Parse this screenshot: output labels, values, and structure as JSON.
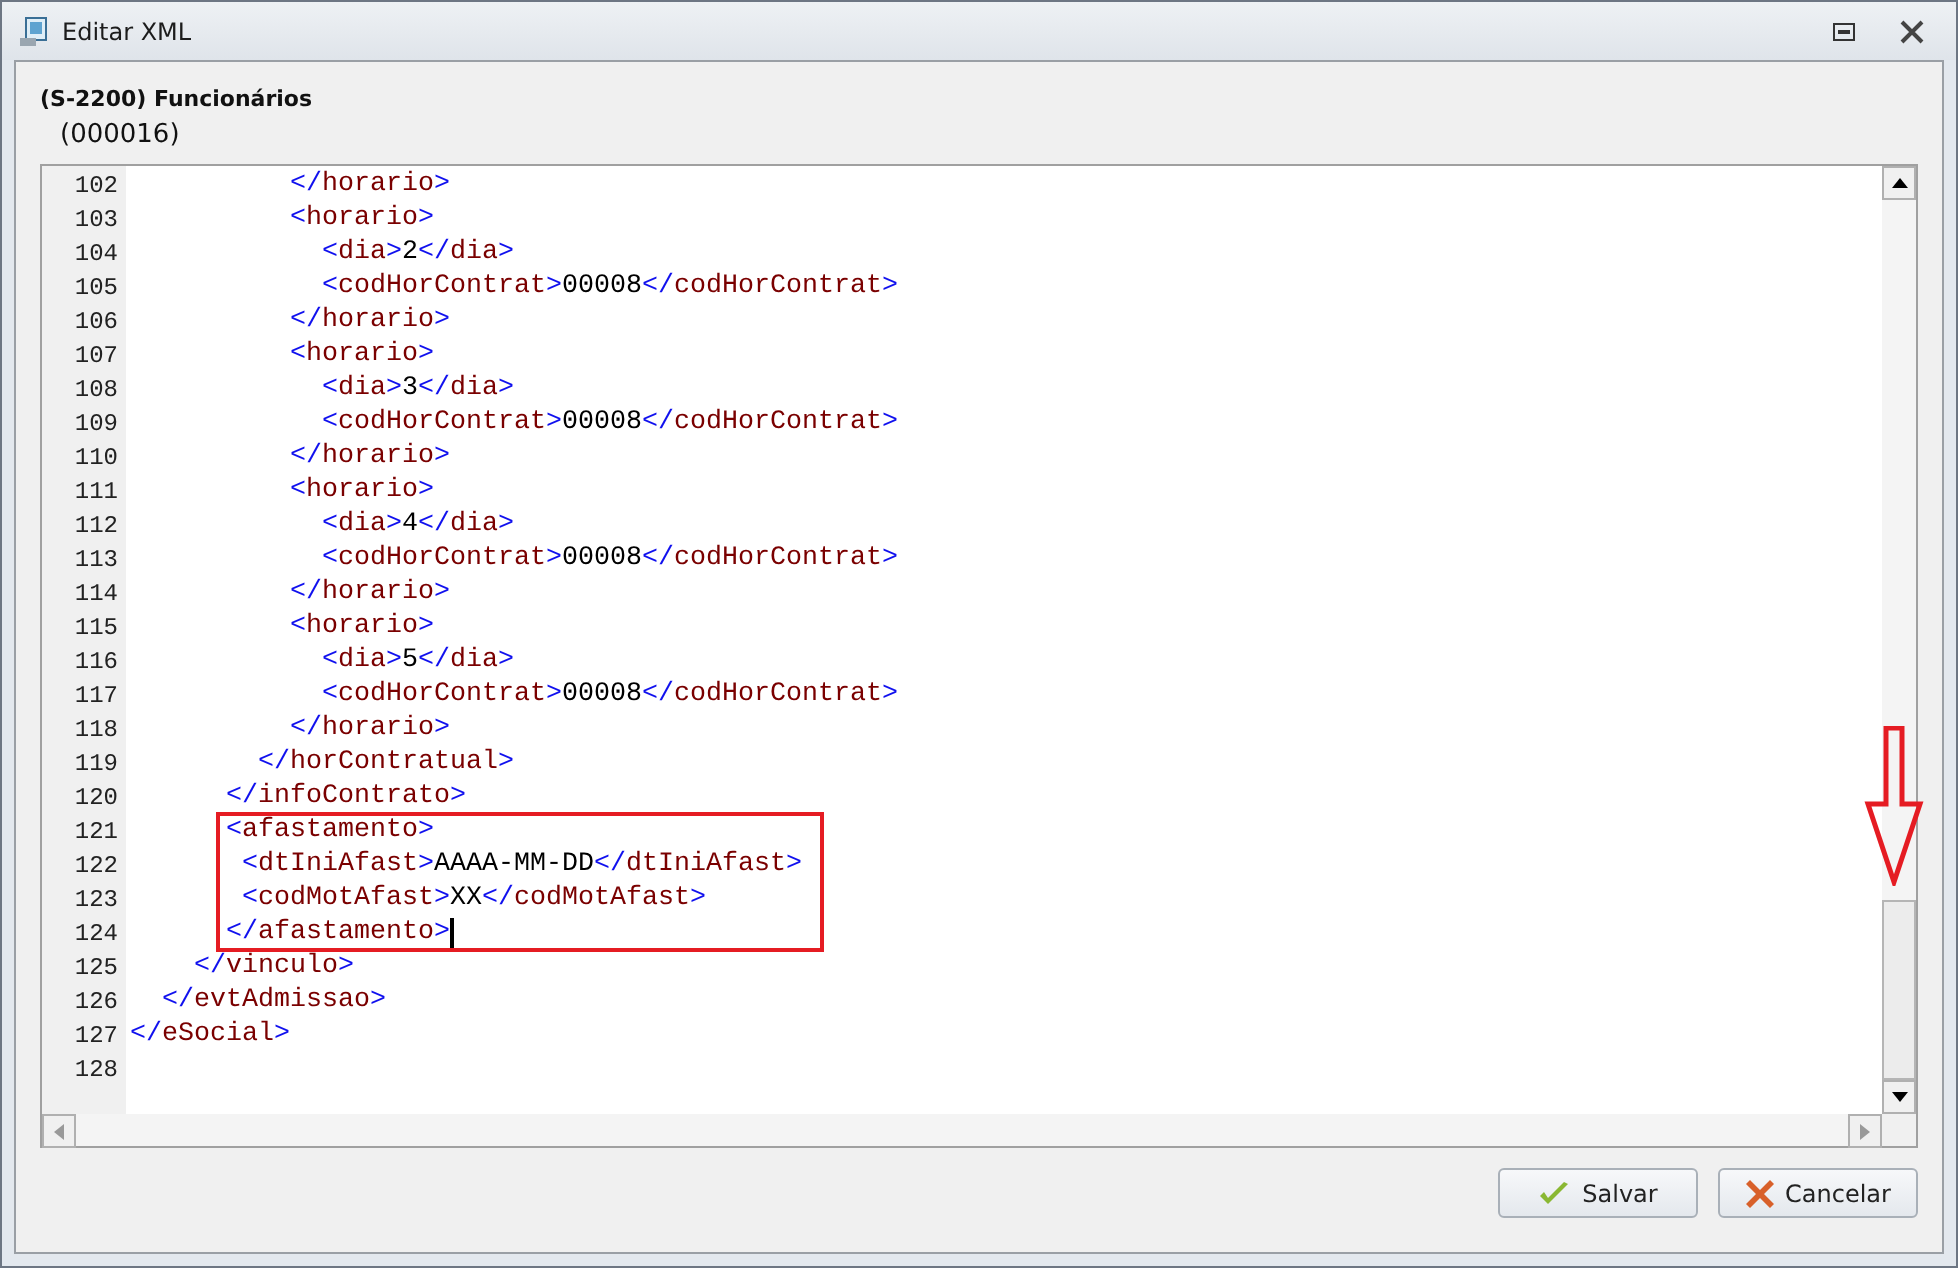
{
  "window": {
    "title": "Editar XML"
  },
  "header": {
    "title": "(S-2200) Funcionários",
    "code": "(000016)"
  },
  "editor": {
    "lines": [
      {
        "number": "102",
        "parts": [
          {
            "kind": "punct",
            "text": "          </"
          },
          {
            "kind": "name",
            "text": "horario"
          },
          {
            "kind": "punct",
            "text": ">"
          }
        ]
      },
      {
        "number": "103",
        "parts": [
          {
            "kind": "punct",
            "text": "          <"
          },
          {
            "kind": "name",
            "text": "horario"
          },
          {
            "kind": "punct",
            "text": ">"
          }
        ]
      },
      {
        "number": "104",
        "parts": [
          {
            "kind": "punct",
            "text": "            <"
          },
          {
            "kind": "name",
            "text": "dia"
          },
          {
            "kind": "punct",
            "text": ">"
          },
          {
            "kind": "text",
            "text": "2"
          },
          {
            "kind": "punct",
            "text": "</"
          },
          {
            "kind": "name",
            "text": "dia"
          },
          {
            "kind": "punct",
            "text": ">"
          }
        ]
      },
      {
        "number": "105",
        "parts": [
          {
            "kind": "punct",
            "text": "            <"
          },
          {
            "kind": "name",
            "text": "codHorContrat"
          },
          {
            "kind": "punct",
            "text": ">"
          },
          {
            "kind": "text",
            "text": "00008"
          },
          {
            "kind": "punct",
            "text": "</"
          },
          {
            "kind": "name",
            "text": "codHorContrat"
          },
          {
            "kind": "punct",
            "text": ">"
          }
        ]
      },
      {
        "number": "106",
        "parts": [
          {
            "kind": "punct",
            "text": "          </"
          },
          {
            "kind": "name",
            "text": "horario"
          },
          {
            "kind": "punct",
            "text": ">"
          }
        ]
      },
      {
        "number": "107",
        "parts": [
          {
            "kind": "punct",
            "text": "          <"
          },
          {
            "kind": "name",
            "text": "horario"
          },
          {
            "kind": "punct",
            "text": ">"
          }
        ]
      },
      {
        "number": "108",
        "parts": [
          {
            "kind": "punct",
            "text": "            <"
          },
          {
            "kind": "name",
            "text": "dia"
          },
          {
            "kind": "punct",
            "text": ">"
          },
          {
            "kind": "text",
            "text": "3"
          },
          {
            "kind": "punct",
            "text": "</"
          },
          {
            "kind": "name",
            "text": "dia"
          },
          {
            "kind": "punct",
            "text": ">"
          }
        ]
      },
      {
        "number": "109",
        "parts": [
          {
            "kind": "punct",
            "text": "            <"
          },
          {
            "kind": "name",
            "text": "codHorContrat"
          },
          {
            "kind": "punct",
            "text": ">"
          },
          {
            "kind": "text",
            "text": "00008"
          },
          {
            "kind": "punct",
            "text": "</"
          },
          {
            "kind": "name",
            "text": "codHorContrat"
          },
          {
            "kind": "punct",
            "text": ">"
          }
        ]
      },
      {
        "number": "110",
        "parts": [
          {
            "kind": "punct",
            "text": "          </"
          },
          {
            "kind": "name",
            "text": "horario"
          },
          {
            "kind": "punct",
            "text": ">"
          }
        ]
      },
      {
        "number": "111",
        "parts": [
          {
            "kind": "punct",
            "text": "          <"
          },
          {
            "kind": "name",
            "text": "horario"
          },
          {
            "kind": "punct",
            "text": ">"
          }
        ]
      },
      {
        "number": "112",
        "parts": [
          {
            "kind": "punct",
            "text": "            <"
          },
          {
            "kind": "name",
            "text": "dia"
          },
          {
            "kind": "punct",
            "text": ">"
          },
          {
            "kind": "text",
            "text": "4"
          },
          {
            "kind": "punct",
            "text": "</"
          },
          {
            "kind": "name",
            "text": "dia"
          },
          {
            "kind": "punct",
            "text": ">"
          }
        ]
      },
      {
        "number": "113",
        "parts": [
          {
            "kind": "punct",
            "text": "            <"
          },
          {
            "kind": "name",
            "text": "codHorContrat"
          },
          {
            "kind": "punct",
            "text": ">"
          },
          {
            "kind": "text",
            "text": "00008"
          },
          {
            "kind": "punct",
            "text": "</"
          },
          {
            "kind": "name",
            "text": "codHorContrat"
          },
          {
            "kind": "punct",
            "text": ">"
          }
        ]
      },
      {
        "number": "114",
        "parts": [
          {
            "kind": "punct",
            "text": "          </"
          },
          {
            "kind": "name",
            "text": "horario"
          },
          {
            "kind": "punct",
            "text": ">"
          }
        ]
      },
      {
        "number": "115",
        "parts": [
          {
            "kind": "punct",
            "text": "          <"
          },
          {
            "kind": "name",
            "text": "horario"
          },
          {
            "kind": "punct",
            "text": ">"
          }
        ]
      },
      {
        "number": "116",
        "parts": [
          {
            "kind": "punct",
            "text": "            <"
          },
          {
            "kind": "name",
            "text": "dia"
          },
          {
            "kind": "punct",
            "text": ">"
          },
          {
            "kind": "text",
            "text": "5"
          },
          {
            "kind": "punct",
            "text": "</"
          },
          {
            "kind": "name",
            "text": "dia"
          },
          {
            "kind": "punct",
            "text": ">"
          }
        ]
      },
      {
        "number": "117",
        "parts": [
          {
            "kind": "punct",
            "text": "            <"
          },
          {
            "kind": "name",
            "text": "codHorContrat"
          },
          {
            "kind": "punct",
            "text": ">"
          },
          {
            "kind": "text",
            "text": "00008"
          },
          {
            "kind": "punct",
            "text": "</"
          },
          {
            "kind": "name",
            "text": "codHorContrat"
          },
          {
            "kind": "punct",
            "text": ">"
          }
        ]
      },
      {
        "number": "118",
        "parts": [
          {
            "kind": "punct",
            "text": "          </"
          },
          {
            "kind": "name",
            "text": "horario"
          },
          {
            "kind": "punct",
            "text": ">"
          }
        ]
      },
      {
        "number": "119",
        "parts": [
          {
            "kind": "punct",
            "text": "        </"
          },
          {
            "kind": "name",
            "text": "horContratual"
          },
          {
            "kind": "punct",
            "text": ">"
          }
        ]
      },
      {
        "number": "120",
        "parts": [
          {
            "kind": "punct",
            "text": "      </"
          },
          {
            "kind": "name",
            "text": "infoContrato"
          },
          {
            "kind": "punct",
            "text": ">"
          }
        ]
      },
      {
        "number": "121",
        "highlighted": true,
        "parts": [
          {
            "kind": "punct",
            "text": "      <"
          },
          {
            "kind": "name",
            "text": "afastamento"
          },
          {
            "kind": "punct",
            "text": ">"
          }
        ]
      },
      {
        "number": "122",
        "highlighted": true,
        "parts": [
          {
            "kind": "punct",
            "text": "       <"
          },
          {
            "kind": "name",
            "text": "dtIniAfast"
          },
          {
            "kind": "punct",
            "text": ">"
          },
          {
            "kind": "text",
            "text": "AAAA-MM-DD"
          },
          {
            "kind": "punct",
            "text": "</"
          },
          {
            "kind": "name",
            "text": "dtIniAfast"
          },
          {
            "kind": "punct",
            "text": ">"
          }
        ]
      },
      {
        "number": "123",
        "highlighted": true,
        "parts": [
          {
            "kind": "punct",
            "text": "       <"
          },
          {
            "kind": "name",
            "text": "codMotAfast"
          },
          {
            "kind": "punct",
            "text": ">"
          },
          {
            "kind": "text",
            "text": "XX"
          },
          {
            "kind": "punct",
            "text": "</"
          },
          {
            "kind": "name",
            "text": "codMotAfast"
          },
          {
            "kind": "punct",
            "text": ">"
          }
        ]
      },
      {
        "number": "124",
        "highlighted": true,
        "cursor": true,
        "parts": [
          {
            "kind": "punct",
            "text": "      </"
          },
          {
            "kind": "name",
            "text": "afastamento"
          },
          {
            "kind": "punct",
            "text": ">"
          }
        ]
      },
      {
        "number": "125",
        "parts": [
          {
            "kind": "punct",
            "text": "    </"
          },
          {
            "kind": "name",
            "text": "vinculo"
          },
          {
            "kind": "punct",
            "text": ">"
          }
        ]
      },
      {
        "number": "126",
        "parts": [
          {
            "kind": "punct",
            "text": "  </"
          },
          {
            "kind": "name",
            "text": "evtAdmissao"
          },
          {
            "kind": "punct",
            "text": ">"
          }
        ]
      },
      {
        "number": "127",
        "parts": [
          {
            "kind": "punct",
            "text": "</"
          },
          {
            "kind": "name",
            "text": "eSocial"
          },
          {
            "kind": "punct",
            "text": ">"
          }
        ]
      },
      {
        "number": "128"
      }
    ]
  },
  "buttons": [
    {
      "kind": "save",
      "label": "Salvar"
    },
    {
      "kind": "cancel",
      "label": "Cancelar"
    }
  ]
}
